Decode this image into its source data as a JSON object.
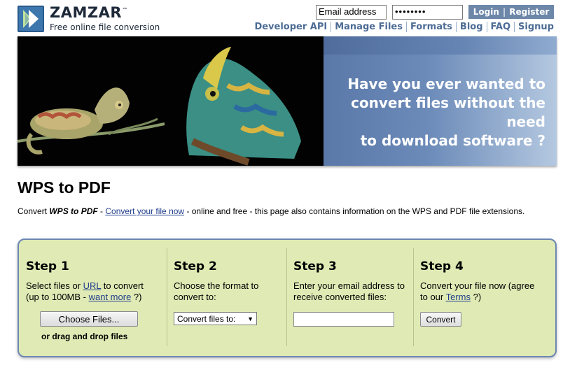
{
  "header": {
    "brand": "ZAMZAR",
    "trademark": "™",
    "tagline": "Free online file conversion",
    "email_placeholder": "Email address",
    "password_value": "••••••••",
    "login_label": "Login",
    "login_sep": "|",
    "register_label": "Register",
    "nav": [
      "Developer API",
      "Manage Files",
      "Formats",
      "Blog",
      "FAQ",
      "Signup"
    ]
  },
  "banner": {
    "line1": "Have you ever wanted to",
    "line2": "convert files without the need",
    "line3": "to download software ?"
  },
  "page": {
    "title": "WPS to PDF",
    "intro_prefix": "Convert ",
    "intro_emph": "WPS to PDF",
    "intro_dash": " - ",
    "intro_link": "Convert your file now",
    "intro_suffix": " - online and free - this page also contains information on the WPS and PDF file extensions."
  },
  "steps": [
    {
      "title": "Step 1",
      "text_a": "Select files or ",
      "link_a": "URL",
      "text_b": " to convert",
      "text_c": "(up to 100MB - ",
      "link_b": "want more",
      "text_d": " ?)",
      "button_label": "Choose Files...",
      "drag_label": "or drag and drop files"
    },
    {
      "title": "Step 2",
      "text_a": "Choose the format to",
      "text_b": "convert to:",
      "select_value": "Convert files to:",
      "select_arrow": "▼"
    },
    {
      "title": "Step 3",
      "text_a": "Enter your email address to",
      "text_b": "receive converted files:"
    },
    {
      "title": "Step 4",
      "text_a": "Convert your file now (agree",
      "text_b": "to our ",
      "link_a": "Terms",
      "text_c": " ?)",
      "button_label": "Convert"
    }
  ],
  "colors": {
    "brand_blue": "#3d77ad",
    "nav_link": "#4d6c96",
    "login_bg": "#6d87a9",
    "steps_bg": "#dfeab5",
    "steps_border": "#6c87b2",
    "link": "#233f8c"
  },
  "icons": {
    "logo": "double-chevron-right-icon"
  }
}
